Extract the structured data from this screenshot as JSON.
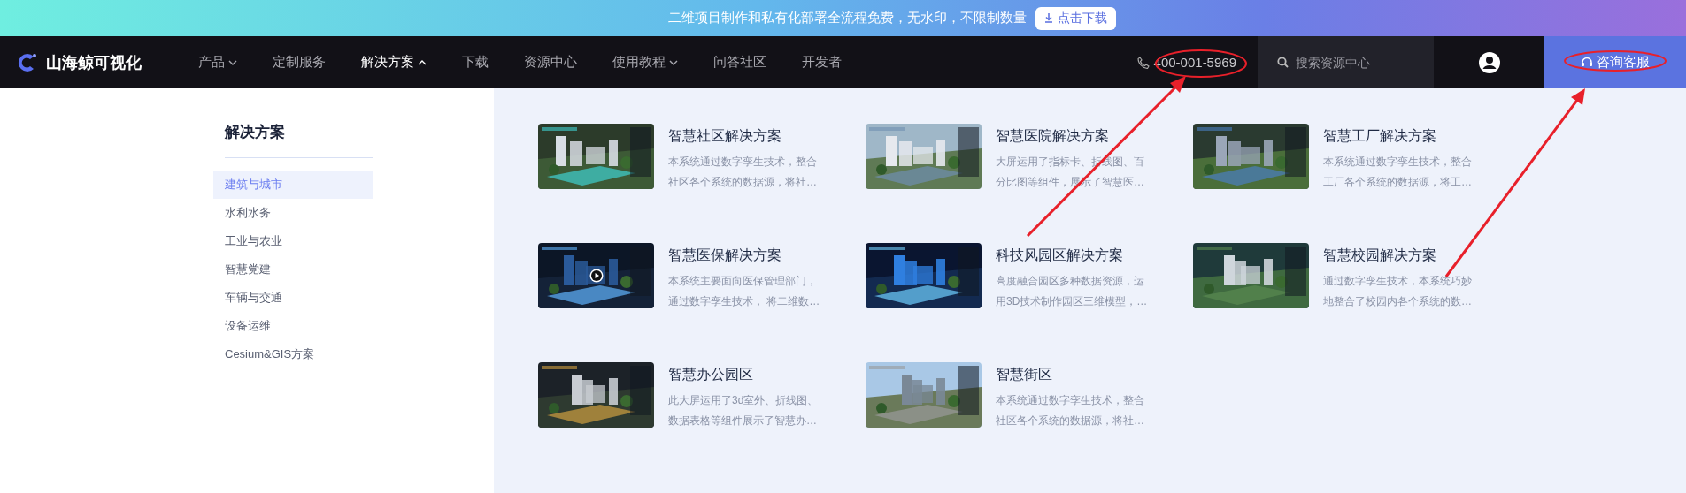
{
  "banner": {
    "text": "二维项目制作和私有化部署全流程免费，无水印，不限制数量",
    "button": "点击下载"
  },
  "header": {
    "logo": "山海鲸可视化",
    "nav": [
      {
        "label": "产品",
        "kind": "dropdown",
        "expanded": false,
        "selected": false
      },
      {
        "label": "定制服务",
        "kind": "link",
        "selected": false
      },
      {
        "label": "解决方案",
        "kind": "dropdown",
        "expanded": true,
        "selected": true
      },
      {
        "label": "下载",
        "kind": "link",
        "selected": false
      },
      {
        "label": "资源中心",
        "kind": "link",
        "selected": false
      },
      {
        "label": "使用教程",
        "kind": "dropdown",
        "expanded": false,
        "selected": false
      },
      {
        "label": "问答社区",
        "kind": "link",
        "selected": false
      },
      {
        "label": "开发者",
        "kind": "link",
        "selected": false
      }
    ],
    "phone": "400-001-5969",
    "search": {
      "placeholder": "搜索资源中心"
    },
    "consult_button": "咨询客服"
  },
  "sidebar": {
    "title": "解决方案",
    "items": [
      {
        "label": "建筑与城市",
        "selected": true
      },
      {
        "label": "水利水务",
        "selected": false
      },
      {
        "label": "工业与农业",
        "selected": false
      },
      {
        "label": "智慧党建",
        "selected": false
      },
      {
        "label": "车辆与交通",
        "selected": false
      },
      {
        "label": "设备运维",
        "selected": false
      },
      {
        "label": "Cesium&GIS方案",
        "selected": false
      }
    ]
  },
  "cards": [
    {
      "title": "智慧社区解决方案",
      "lines": [
        "本系统通过数字孪生技术，整合",
        "社区各个系统的数据源，将社…"
      ],
      "video": false
    },
    {
      "title": "智慧医院解决方案",
      "lines": [
        "大屏运用了指标卡、折线图、百",
        "分比图等组件，展示了智慧医…"
      ],
      "video": false
    },
    {
      "title": "智慧工厂解决方案",
      "lines": [
        "本系统通过数字孪生技术，整合",
        "工厂各个系统的数据源，将工…"
      ],
      "video": false
    },
    {
      "title": "智慧医保解决方案",
      "lines": [
        "本系统主要面向医保管理部门，",
        "通过数字孪生技术， 将二维数…"
      ],
      "video": true
    },
    {
      "title": "科技风园区解决方案",
      "lines": [
        "高度融合园区多种数据资源，运",
        "用3D技术制作园区三维模型，…"
      ],
      "video": false
    },
    {
      "title": "智慧校园解决方案",
      "lines": [
        "通过数字孪生技术，本系统巧妙",
        "地整合了校园内各个系统的数…"
      ],
      "video": false
    },
    {
      "title": "智慧办公园区",
      "lines": [
        "此大屏运用了3d室外、折线图、",
        "数据表格等组件展示了智慧办…"
      ],
      "video": false
    },
    {
      "title": "智慧街区",
      "lines": [
        "本系统通过数字孪生技术，整合",
        "社区各个系统的数据源，将社…"
      ],
      "video": false
    }
  ]
}
